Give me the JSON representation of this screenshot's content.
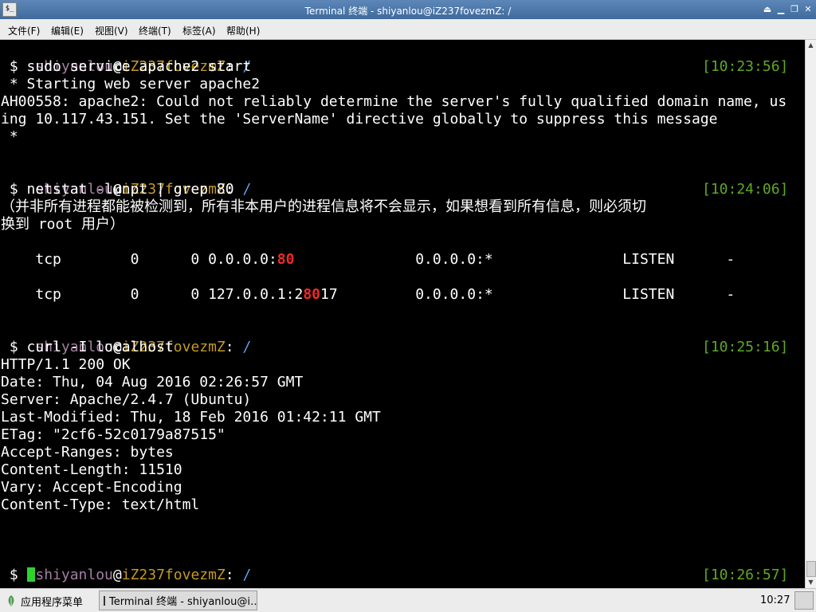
{
  "window": {
    "title": "Terminal 终端 - shiyanlou@iZ237fovezmZ: /",
    "app_icon_glyph": "$_",
    "controls": [
      "⏏",
      "▁",
      "❐",
      "✕"
    ]
  },
  "menu": [
    {
      "label": "文件(F)"
    },
    {
      "label": "编辑(E)"
    },
    {
      "label": "视图(V)"
    },
    {
      "label": "终端(T)"
    },
    {
      "label": "标签(A)"
    },
    {
      "label": "帮助(H)"
    }
  ],
  "colors": {
    "username": "#a57ea3",
    "hostname": "#c59a22",
    "path": "#5ea2ec",
    "timestamp": "#5fa826",
    "highlight": "#ef2929",
    "cursor": "#2fd12f"
  },
  "terminal": {
    "prompt1": {
      "user": "shiyanlou",
      "at": "@",
      "host": "iZ237fovezmZ",
      "sep": ": ",
      "path": "/"
    },
    "cmd1": " $ sudo service apache2 start",
    "ts1": "[10:23:56]",
    "out1": [
      " * Starting web server apache2",
      "AH00558: apache2: Could not reliably determine the server's fully qualified domain name, us",
      "ing 10.117.43.151. Set the 'ServerName' directive globally to suppress this message",
      " *"
    ],
    "prompt2": {
      "user": "shiyanlou",
      "at": "@",
      "host": "iZ237fovezmZ",
      "sep": ": ",
      "path": "/"
    },
    "cmd2": " $ netstat -lunpt | grep 80",
    "ts2": "[10:24:06]",
    "out2": [
      "（并非所有进程都能被检测到，所有非本用户的进程信息将不会显示，如果想看到所有信息，则必须切",
      "换到 root 用户）"
    ],
    "row1": {
      "a": "tcp        0      0 0.0.0.0:",
      "b": "80",
      "c": "              0.0.0.0:*               LISTEN      -"
    },
    "row2": {
      "a": "tcp        0      0 127.0.0.1:2",
      "b": "80",
      "c": "17         0.0.0.0:*               LISTEN      -"
    },
    "prompt3": {
      "user": "shiyanlou",
      "at": "@",
      "host": "iZ237fovezmZ",
      "sep": ": ",
      "path": "/"
    },
    "cmd3": " $ curl -I localhost",
    "ts3": "[10:25:16]",
    "out3": [
      "HTTP/1.1 200 OK",
      "Date: Thu, 04 Aug 2016 02:26:57 GMT",
      "Server: Apache/2.4.7 (Ubuntu)",
      "Last-Modified: Thu, 18 Feb 2016 01:42:11 GMT",
      "ETag: \"2cf6-52c0179a87515\"",
      "Accept-Ranges: bytes",
      "Content-Length: 11510",
      "Vary: Accept-Encoding",
      "Content-Type: text/html"
    ],
    "prompt4": {
      "user": "shiyanlou",
      "at": "@",
      "host": "iZ237fovezmZ",
      "sep": ": ",
      "path": "/"
    },
    "cmd4": " $ ",
    "ts4": "[10:26:57]"
  },
  "taskbar": {
    "start_label": "应用程序菜单",
    "task_label": "Terminal 终端 - shiyanlou@i…",
    "clock": "10:27"
  }
}
